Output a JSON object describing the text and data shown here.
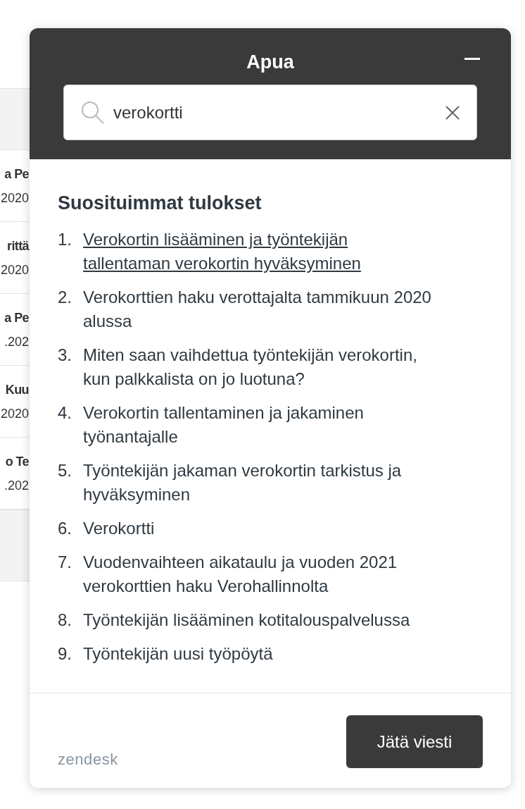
{
  "background_list": {
    "rows": [
      {
        "title": "a Pe",
        "date": "2020"
      },
      {
        "title": "rittä",
        "date": "2020"
      },
      {
        "title": "a Pe",
        "date": ".202"
      },
      {
        "title": "Kuu",
        "date": "2020"
      },
      {
        "title": "o Te",
        "date": ".202"
      }
    ]
  },
  "help_widget": {
    "title": "Apua",
    "search": {
      "value": "verokortti"
    },
    "heading": "Suosituimmat tulokset",
    "results": [
      {
        "number": "1.",
        "text": "Verokortin lisääminen ja työntekijän tallentaman verokortin hyväksyminen",
        "underlined": true
      },
      {
        "number": "2.",
        "text": "Verokorttien haku verottajalta tammikuun 2020 alussa",
        "underlined": false
      },
      {
        "number": "3.",
        "text": "Miten saan vaihdettua työntekijän verokortin, kun palkkalista on jo luotuna?",
        "underlined": false
      },
      {
        "number": "4.",
        "text": "Verokortin tallentaminen ja jakaminen työnantajalle",
        "underlined": false
      },
      {
        "number": "5.",
        "text": "Työntekijän jakaman verokortin tarkistus ja hyväksyminen",
        "underlined": false
      },
      {
        "number": "6.",
        "text": "Verokortti",
        "underlined": false
      },
      {
        "number": "7.",
        "text": "Vuodenvaihteen aikataulu ja vuoden 2021 verokorttien haku Verohallinnolta",
        "underlined": false
      },
      {
        "number": "8.",
        "text": "Työntekijän lisääminen kotitalouspalvelussa",
        "underlined": false
      },
      {
        "number": "9.",
        "text": "Työntekijän uusi työpöytä",
        "underlined": false
      }
    ],
    "brand": "zendesk",
    "button": "Jätä viesti"
  }
}
